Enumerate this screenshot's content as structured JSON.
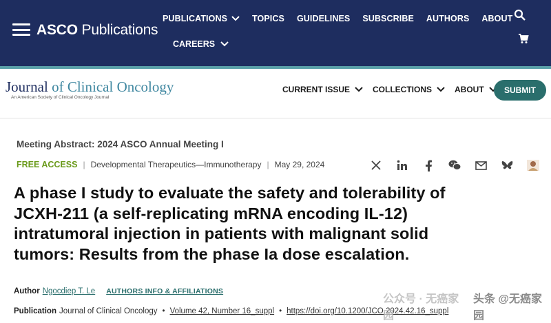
{
  "topbar": {
    "brand_bold": "ASCO",
    "brand_light": "Publications",
    "nav": [
      {
        "label": "PUBLICATIONS",
        "has_dropdown": true
      },
      {
        "label": "TOPICS",
        "has_dropdown": false
      },
      {
        "label": "GUIDELINES",
        "has_dropdown": false
      },
      {
        "label": "SUBSCRIBE",
        "has_dropdown": false
      },
      {
        "label": "AUTHORS",
        "has_dropdown": false
      },
      {
        "label": "ABOUT",
        "has_dropdown": false
      }
    ],
    "careers": "CAREERS",
    "icons": [
      "search-icon",
      "cart-icon"
    ],
    "bg_color": "#1e2d5f"
  },
  "journal": {
    "title_part1": "Journal ",
    "title_of": "of ",
    "title_part2": "Clinical Oncology",
    "subtitle": "An American Society of Clinical Oncology Journal",
    "nav": [
      {
        "label": "CURRENT ISSUE"
      },
      {
        "label": "COLLECTIONS"
      },
      {
        "label": "ABOUT"
      }
    ],
    "submit_label": "SUBMIT",
    "accent_color": "#2a6e6c"
  },
  "article": {
    "meeting": "Meeting Abstract: 2024 ASCO Annual Meeting I",
    "access": "FREE ACCESS",
    "category": "Developmental Therapeutics—Immunotherapy",
    "date": "May 29, 2024",
    "share_icons": [
      "x-icon",
      "linkedin-icon",
      "facebook-icon",
      "wechat-icon",
      "email-icon",
      "bluesky-icon",
      "avatar-icon"
    ],
    "title_lines": [
      "A phase I study to evaluate the safety and tolerability of",
      "JCXH-211 (a self-replicating mRNA encoding IL-12)",
      "intratumoral injection in patients with malignant solid",
      "tumors: Results from the phase Ia dose escalation."
    ],
    "author_label": "Author",
    "author_name": "Ngocdiep T. Le",
    "affiliations": "AUTHORS INFO & AFFILIATIONS",
    "publication_label": "Publication",
    "publication_journal": "Journal of Clinical Oncology",
    "volume": "Volume 42, Number 16_suppl",
    "doi": "https://doi.org/10.1200/JCO.2024.42.16_suppl"
  },
  "watermark": {
    "text1": "公众号 · 无癌家园",
    "text2": "头条 @无癌家园"
  }
}
